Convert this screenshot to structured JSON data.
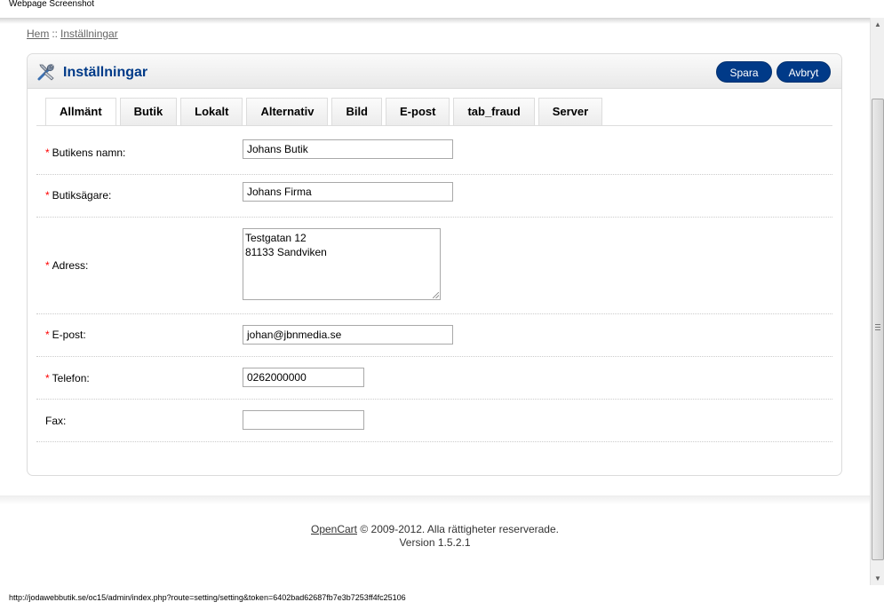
{
  "window": {
    "title": "Webpage Screenshot"
  },
  "breadcrumb": {
    "home": "Hem",
    "separator": "::",
    "current": "Inställningar"
  },
  "heading": {
    "title": "Inställningar",
    "icon": "tools-icon"
  },
  "buttons": {
    "save": "Spara",
    "cancel": "Avbryt"
  },
  "tabs": [
    {
      "label": "Allmänt",
      "active": true
    },
    {
      "label": "Butik"
    },
    {
      "label": "Lokalt"
    },
    {
      "label": "Alternativ"
    },
    {
      "label": "Bild"
    },
    {
      "label": "E-post"
    },
    {
      "label": "tab_fraud"
    },
    {
      "label": "Server"
    }
  ],
  "form": {
    "store_name": {
      "label": "Butikens namn:",
      "value": "Johans Butik",
      "required": true
    },
    "owner": {
      "label": "Butiksägare:",
      "value": "Johans Firma",
      "required": true
    },
    "address": {
      "label": "Adress:",
      "value": "Testgatan 12\n81133 Sandviken",
      "required": true
    },
    "email": {
      "label": "E-post:",
      "value": "johan@jbnmedia.se",
      "required": true
    },
    "phone": {
      "label": "Telefon:",
      "value": "0262000000",
      "required": true
    },
    "fax": {
      "label": "Fax:",
      "value": "",
      "required": false
    },
    "required_mark": "*"
  },
  "footer": {
    "link": "OpenCart",
    "copyright": " © 2009-2012. Alla rättigheter reserverade.",
    "version": "Version 1.5.2.1"
  },
  "status_bar": {
    "url": "http://jodawebbutik.se/oc15/admin/index.php?route=setting/setting&token=6402bad62687fb7e3b7253ff4fc25106"
  },
  "colors": {
    "accent": "#003a88",
    "required": "#ff0000"
  }
}
